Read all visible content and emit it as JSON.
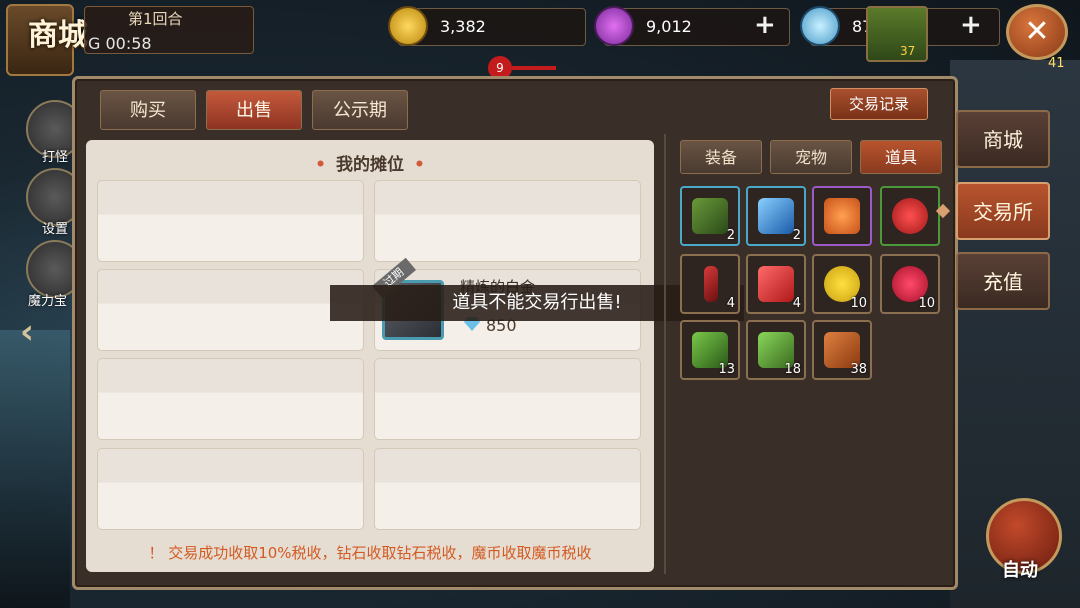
{
  "header": {
    "store_title": "商城",
    "round_label": "第1回合",
    "timer": "G  00:58",
    "coins": "3,382",
    "purple_gems": "9,012",
    "diamonds": "87",
    "plus_symbol": "+",
    "close_symbol": "✕",
    "player_level": "41",
    "pet_level": "37",
    "hp_badge": "9"
  },
  "side_menu": {
    "items": [
      {
        "label": "打怪"
      },
      {
        "label": "设置"
      },
      {
        "label": "魔力宝"
      }
    ]
  },
  "tabs": [
    {
      "label": "购买"
    },
    {
      "label": "出售"
    },
    {
      "label": "公示期"
    }
  ],
  "trade_record_label": "交易记录",
  "stall": {
    "title": "我的摊位",
    "tax_note": "！ 交易成功收取10%税收，钻石收取钻石税收，魔币收取魔币税收",
    "listed_item": {
      "name": "精炼的白金",
      "price": "850",
      "ribbon": "过期"
    }
  },
  "toast": "道具不能交易行出售!",
  "inventory": {
    "categories": [
      {
        "label": "装备"
      },
      {
        "label": "宠物"
      },
      {
        "label": "道具"
      }
    ],
    "items": [
      {
        "icon": "monster-card-icon",
        "count": "2"
      },
      {
        "icon": "blue-potion-icon",
        "count": "2"
      },
      {
        "icon": "orange-slime-card-icon",
        "count": ""
      },
      {
        "icon": "red-potion-icon",
        "count": ""
      },
      {
        "icon": "red-vial-icon",
        "count": "4"
      },
      {
        "icon": "red-bottle-icon",
        "count": "4"
      },
      {
        "icon": "yellow-flower-icon",
        "count": "10"
      },
      {
        "icon": "red-flower-icon",
        "count": "10"
      },
      {
        "icon": "herb-branch-icon",
        "count": "13"
      },
      {
        "icon": "herb-sprig-icon",
        "count": "18"
      },
      {
        "icon": "copper-ore-icon",
        "count": "38"
      }
    ]
  },
  "right_nav": [
    {
      "label": "商城"
    },
    {
      "label": "交易所"
    },
    {
      "label": "充值"
    }
  ],
  "auto_label": "自动",
  "colors": {
    "accent": "#b8542e",
    "panel": "#3a2e28",
    "stall_bg": "#e6ddd2",
    "tax_text": "#d35a22"
  }
}
